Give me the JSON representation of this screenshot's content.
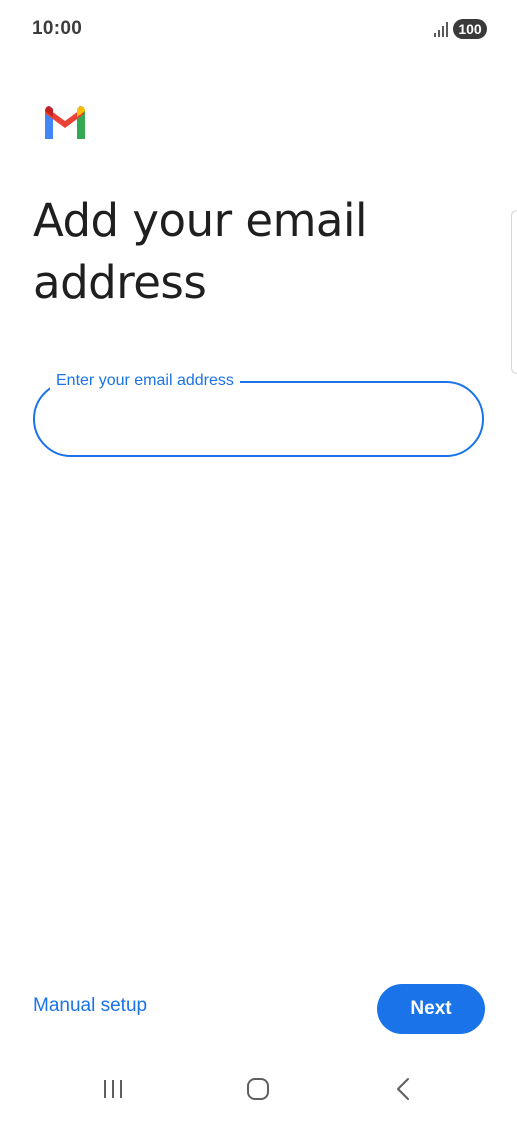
{
  "status_bar": {
    "time": "10:00",
    "battery": "100",
    "signal_icon": "signal-bars-icon"
  },
  "app": {
    "logo_icon": "gmail-logo-icon",
    "colors": {
      "accent": "#1a73e8",
      "gmail_blue": "#4285f4",
      "gmail_red": "#ea4335",
      "gmail_yellow": "#fbbc04",
      "gmail_green": "#34a853",
      "gmail_dark_red": "#c5221f"
    }
  },
  "main": {
    "title": "Add your email address",
    "email_field": {
      "label": "Enter your email address",
      "value": ""
    }
  },
  "footer": {
    "manual_setup_label": "Manual setup",
    "next_label": "Next"
  },
  "nav_bar": {
    "recents_icon": "recents-icon",
    "home_icon": "home-icon",
    "back_icon": "back-icon"
  }
}
